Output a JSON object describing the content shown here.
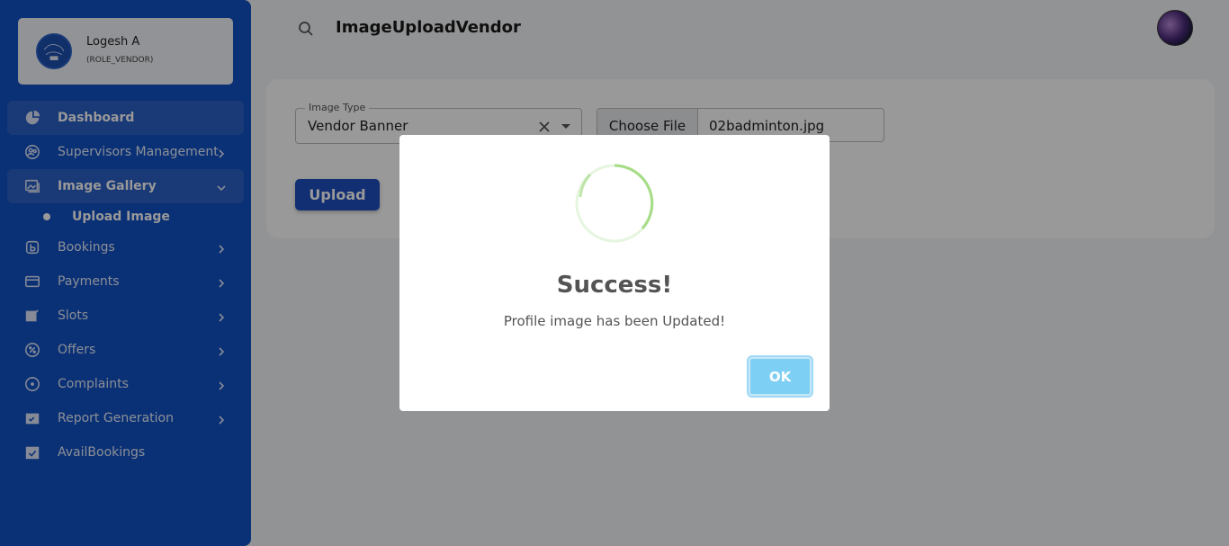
{
  "user": {
    "name": "Logesh A",
    "role": "(ROLE_VENDOR)"
  },
  "sidebar": {
    "items": [
      {
        "label": "Dashboard",
        "icon": "pie-chart-icon",
        "state": "active"
      },
      {
        "label": "Supervisors Management",
        "icon": "people-circle-icon",
        "state": "collapsed"
      },
      {
        "label": "Image Gallery",
        "icon": "image-gallery-icon",
        "state": "expanded"
      },
      {
        "label": "Bookings",
        "icon": "bookings-icon",
        "state": "collapsed"
      },
      {
        "label": "Payments",
        "icon": "credit-card-icon",
        "state": "collapsed"
      },
      {
        "label": "Slots",
        "icon": "edit-note-icon",
        "state": "collapsed"
      },
      {
        "label": "Offers",
        "icon": "discount-icon",
        "state": "collapsed"
      },
      {
        "label": "Complaints",
        "icon": "target-circle-icon",
        "state": "collapsed"
      },
      {
        "label": "Report Generation",
        "icon": "calendar-check-icon",
        "state": "collapsed"
      },
      {
        "label": "AvailBookings",
        "icon": "calendar-icon",
        "state": "none"
      }
    ],
    "subitem": {
      "label": "Upload Image"
    }
  },
  "header": {
    "title": "ImageUploadVendor"
  },
  "form": {
    "image_type_label": "Image Type",
    "image_type_value": "Vendor Banner",
    "file_button": "Choose File",
    "file_name": "02badminton.jpg",
    "upload_label": "Upload"
  },
  "modal": {
    "title": "Success!",
    "message": "Profile image has been Updated!",
    "ok_label": "OK",
    "icon": "success-spinner-icon"
  },
  "colors": {
    "sidebar": "#1251c4",
    "primary_button": "#1e4fc0",
    "ok_button": "#7ecff4",
    "success_ring": "#a5dc86"
  }
}
